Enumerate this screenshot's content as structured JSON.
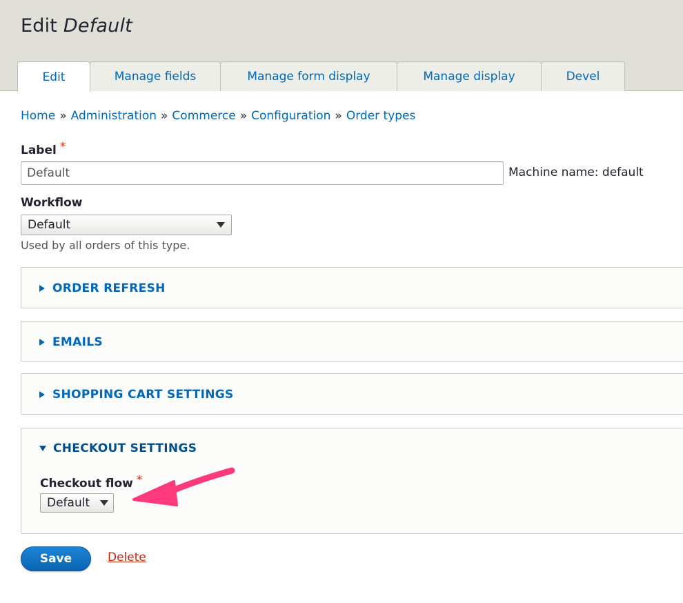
{
  "page": {
    "title_prefix": "Edit",
    "title_emphasis": "Default"
  },
  "tabs": [
    {
      "label": "Edit",
      "active": true
    },
    {
      "label": "Manage fields",
      "active": false
    },
    {
      "label": "Manage form display",
      "active": false
    },
    {
      "label": "Manage display",
      "active": false
    },
    {
      "label": "Devel",
      "active": false
    }
  ],
  "breadcrumb": {
    "items": [
      "Home",
      "Administration",
      "Commerce",
      "Configuration",
      "Order types"
    ],
    "separator": "»"
  },
  "form": {
    "label": {
      "title": "Label",
      "required_marker": "*",
      "value": "Default",
      "machine_name": "Machine name: default"
    },
    "workflow": {
      "title": "Workflow",
      "selected": "Default",
      "description": "Used by all orders of this type."
    },
    "sections": [
      {
        "title": "ORDER REFRESH",
        "open": false
      },
      {
        "title": "EMAILS",
        "open": false
      },
      {
        "title": "SHOPPING CART SETTINGS",
        "open": false
      },
      {
        "title": "CHECKOUT SETTINGS",
        "open": true
      }
    ],
    "checkout_flow": {
      "title": "Checkout flow",
      "required_marker": "*",
      "selected": "Default"
    }
  },
  "actions": {
    "save_label": "Save",
    "delete_label": "Delete"
  },
  "colors": {
    "link": "#0067b5",
    "header_bg": "#e0e0d8",
    "required": "#e32700",
    "primary_button": "#1478c8",
    "delete": "#c0290c",
    "annotation_arrow": "#ff3a7c"
  },
  "annotation": {
    "icon": "arrow-annotation-icon"
  }
}
